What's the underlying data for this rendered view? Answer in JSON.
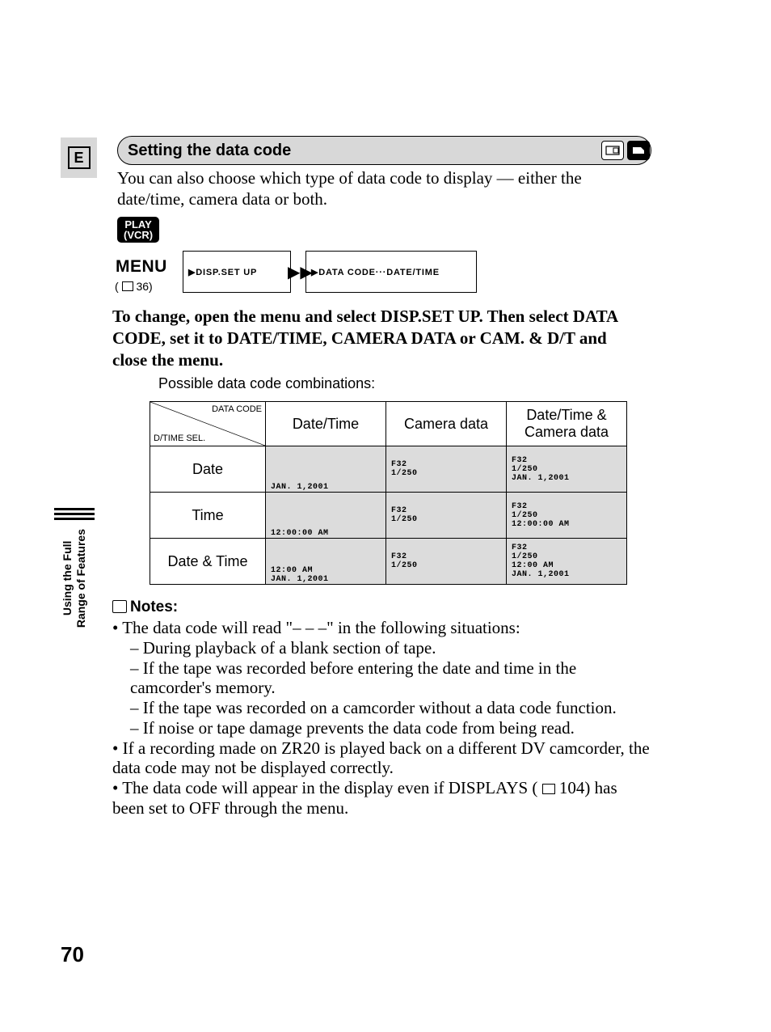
{
  "lang_box": "E",
  "section_title": "Setting the data code",
  "intro": "You can also choose which type of data code to display — either the date/time, camera data or both.",
  "play_vcr_top": "PLAY",
  "play_vcr_bottom": "(VCR)",
  "menu_label": "MENU",
  "menu_ref_page": "36",
  "flow_a": "▶DISP.SET UP",
  "flow_arrow": "▶▶",
  "flow_b": "▶DATA CODE···DATE/TIME",
  "instruction": "To change, open the menu and select DISP.SET UP. Then select DATA CODE, set it to DATE/TIME, CAMERA DATA or CAM. & D/T and close the menu.",
  "possible_caption": "Possible data code combinations:",
  "table": {
    "corner_top": "DATA CODE",
    "corner_bottom": "D/TIME SEL.",
    "col_headers": [
      "Date/Time",
      "Camera data",
      "Date/Time &\nCamera data"
    ],
    "row_headers": [
      "Date",
      "Time",
      "Date & Time"
    ],
    "cells": {
      "r0c0": "JAN. 1,2001",
      "r0c1": "F32\n1/250",
      "r0c2": "F32\n1/250\nJAN. 1,2001",
      "r1c0": "12:00:00 AM",
      "r1c1": "F32\n1/250",
      "r1c2": "F32\n1/250\n12:00:00 AM",
      "r2c0": "12:00 AM\nJAN. 1,2001",
      "r2c1": "F32\n1/250",
      "r2c2": "F32\n1/250\n12:00 AM\nJAN. 1,2001"
    }
  },
  "notes_label": "Notes:",
  "notes": {
    "b1_intro": "The data code will read \"– – –\" in the following situations:",
    "b1_sub": [
      "During playback of a blank section of tape.",
      "If the tape was recorded before entering the date and time in the camcorder's memory.",
      "If the tape was recorded on a camcorder without a data code function.",
      "If noise or tape damage prevents the data code from being read."
    ],
    "b2": "If a recording made on ZR20 is played back on a different DV camcorder, the data code may not be displayed correctly.",
    "b3_pre": "The data code will appear in the display even if DISPLAYS (",
    "b3_page": "104",
    "b3_post": ") has been set to OFF through the menu."
  },
  "sidebar_text": "Using the Full\nRange of Features",
  "page_number": "70"
}
